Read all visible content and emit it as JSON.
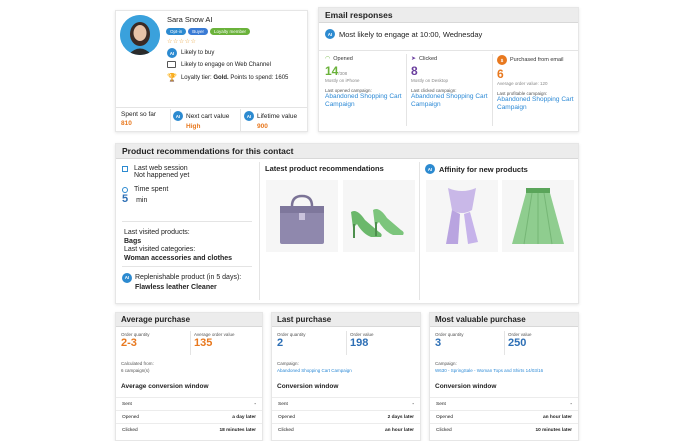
{
  "profile": {
    "name": "Sara Snow AI",
    "tags": [
      {
        "label": "Opt-in",
        "color": "#2c8ad0"
      },
      {
        "label": "Buyer",
        "color": "#3a7bd5"
      },
      {
        "label": "Loyalty member",
        "color": "#6ab23a"
      }
    ],
    "stars": "☆☆☆☆☆",
    "likely_to_buy": "Likely to buy",
    "channel": "Likely to engage on Web Channel",
    "loyalty_prefix": "Loyalty tier: ",
    "loyalty_tier": "Gold.",
    "loyalty_suffix": " Points to spend: 1605",
    "ai_badge": "AI",
    "stats": [
      {
        "label": "Spent so far",
        "value": "810"
      },
      {
        "label": "Next cart value",
        "value": "High"
      },
      {
        "label": "Lifetime value",
        "value": "900"
      }
    ]
  },
  "email": {
    "title": "Email responses",
    "engage": "Most likely to engage at 10:00, Wednesday",
    "metrics": [
      {
        "label": "Opened",
        "value": "14",
        "sub": "/308",
        "note": "Mostly on iPhone",
        "camp_label": "Last opened campaign:",
        "camp": "Abandoned Shopping Cart Campaign"
      },
      {
        "label": "Clicked",
        "value": "8",
        "sub": "",
        "note": "Mostly on Desktop",
        "camp_label": "Last clicked campaign:",
        "camp": "Abandoned Shopping Cart Campaign"
      },
      {
        "label": "Purchased from email",
        "value": "6",
        "sub": "",
        "note": "Average order value: 120",
        "camp_label": "Last profitable campaign:",
        "camp": "Abandoned Shopping Cart Campaign"
      }
    ]
  },
  "recs": {
    "title": "Product recommendations for this contact",
    "last_session_label": "Last web session",
    "last_session_value": "Not happened yet",
    "time_spent_label": "Time spent",
    "time_spent_value": "5",
    "time_spent_unit": "min",
    "visited_products_label": "Last visited products:",
    "visited_products_value": "Bags",
    "visited_categories_label": "Last visited categories:",
    "visited_categories_value": "Woman accessories and clothes",
    "replenish_label": "Replenishable product (in 5 days):",
    "replenish_value": "Flawless leather Cleaner",
    "latest_title": "Latest product recommendations",
    "affinity_title": "Affinity for new products"
  },
  "purchases": [
    {
      "title": "Average purchase",
      "qty_label": "Order quantity",
      "qty": "2-3",
      "val_label": "Average order value",
      "val": "135",
      "extra_label": "Calculated from:",
      "extra": "6 campaign(s)",
      "window_title": "Average conversion window",
      "rows": [
        [
          "Sent",
          "-"
        ],
        [
          "Opened",
          "a day later"
        ],
        [
          "Clicked",
          "18 minutes later"
        ]
      ]
    },
    {
      "title": "Last purchase",
      "qty_label": "Order quantity",
      "qty": "2",
      "val_label": "Order value",
      "val": "198",
      "extra_label": "Campaign:",
      "extra": "Abandoned Shopping Cart Campaign",
      "window_title": "Conversion window",
      "rows": [
        [
          "Sent",
          "-"
        ],
        [
          "Opened",
          "2 days later"
        ],
        [
          "Clicked",
          "an hour later"
        ]
      ]
    },
    {
      "title": "Most valuable purchase",
      "qty_label": "Order quantity",
      "qty": "3",
      "val_label": "Order value",
      "val": "250",
      "extra_label": "Campaign:",
      "extra": "W630 - SpringSale - Woman Tops and Shirts 14/03/16",
      "window_title": "Conversion window",
      "rows": [
        [
          "Sent",
          "-"
        ],
        [
          "Opened",
          "an hour later"
        ],
        [
          "Clicked",
          "10 minutes later"
        ]
      ]
    }
  ],
  "colors": {
    "accent": "#2c8ad0",
    "orange": "#e8781e",
    "green": "#6ab23a",
    "purple": "#6a3e9e",
    "link": "#2d8ad6"
  }
}
